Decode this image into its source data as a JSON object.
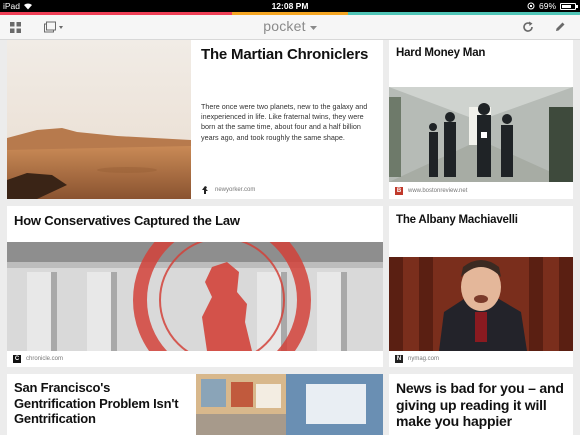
{
  "status_bar": {
    "device": "iPad",
    "time": "12:08 PM",
    "battery": "69%"
  },
  "accent_colors": [
    "#ef3f56",
    "#ef3f56",
    "#f5a623",
    "#50c5b7",
    "#50c5b7"
  ],
  "toolbar": {
    "app_title": "pocket",
    "grid_icon": "grid-icon",
    "list_icon": "list-icon",
    "refresh_icon": "refresh-icon",
    "edit_icon": "pencil-icon"
  },
  "articles": [
    {
      "title": "The Martian Chroniclers",
      "excerpt": "There once were two planets, new to the galaxy and inexperienced in life. Like fraternal twins, they were born at the same time, about four and a half billion years ago, and took roughly the same shape.",
      "source": "newyorker.com"
    },
    {
      "title": "Hard Money Man",
      "source": "www.bostonreview.net"
    },
    {
      "title": "How Conservatives Captured the Law",
      "source": "chronicle.com"
    },
    {
      "title": "The Albany Machiavelli",
      "source": "nymag.com"
    },
    {
      "title": "San Francisco's Gentrification Problem Isn't Gentrification"
    },
    {
      "title": "News is bad for you – and giving up reading it will make you happier"
    }
  ]
}
